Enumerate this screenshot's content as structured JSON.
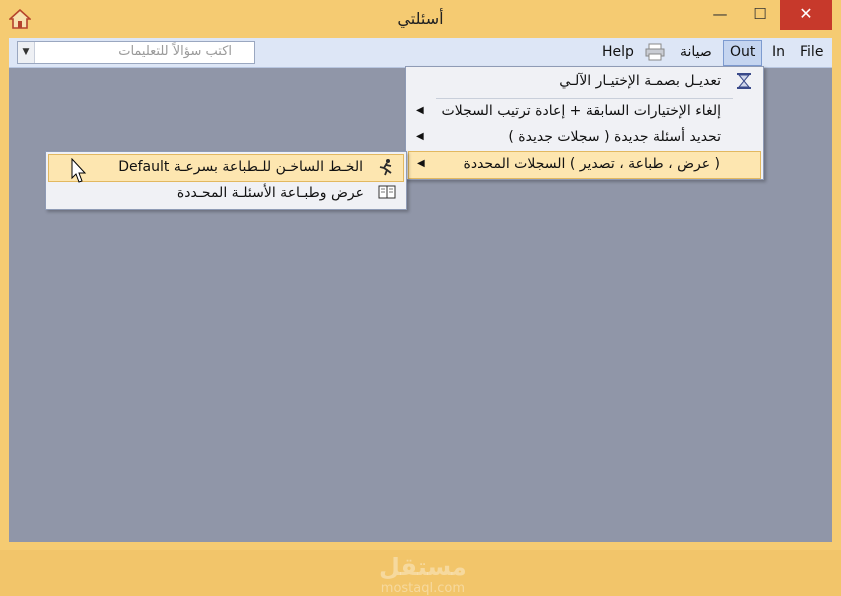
{
  "window": {
    "title": "أسئلتي",
    "controls": {
      "minimize": "—",
      "maximize": "☐",
      "close": "✕"
    }
  },
  "menubar": {
    "items": [
      {
        "label": "File"
      },
      {
        "label": "In"
      },
      {
        "label": "Out"
      },
      {
        "label": "صيانة"
      },
      {
        "label": "Help"
      }
    ],
    "search": {
      "placeholder": "اكتب سؤالاً للتعليمات"
    }
  },
  "out_menu": {
    "items": [
      {
        "label": "تعديـل بصمـة الإختيـار الآلـي",
        "icon": "hourglass-icon"
      },
      {
        "label": "إلغاء الإختيارات السابقة + إعادة ترتيب السجلات",
        "submenu": true
      },
      {
        "label": "تحديد أسئلة جديدة ( سجلات جديدة )",
        "submenu": true
      },
      {
        "label": "( عرض ، طباعة ، تصدير ) السجلات المحددة",
        "submenu": true,
        "highlighted": true
      }
    ]
  },
  "sub_menu": {
    "items": [
      {
        "label": "الخـط الساخـن للـطباعة بسرعـة Default",
        "icon": "running-man-icon",
        "highlighted": true
      },
      {
        "label": "عرض وطبـاعة الأسئلـة المحـددة",
        "icon": "book-icon"
      }
    ]
  },
  "watermark": {
    "line1": "مستقل",
    "line2": "mostaql.com"
  },
  "colors": {
    "frame": "#f5cb72",
    "client": "#9096a8",
    "menubar": "#dde6f6",
    "highlight": "#fde6b0",
    "close": "#c7392b"
  }
}
